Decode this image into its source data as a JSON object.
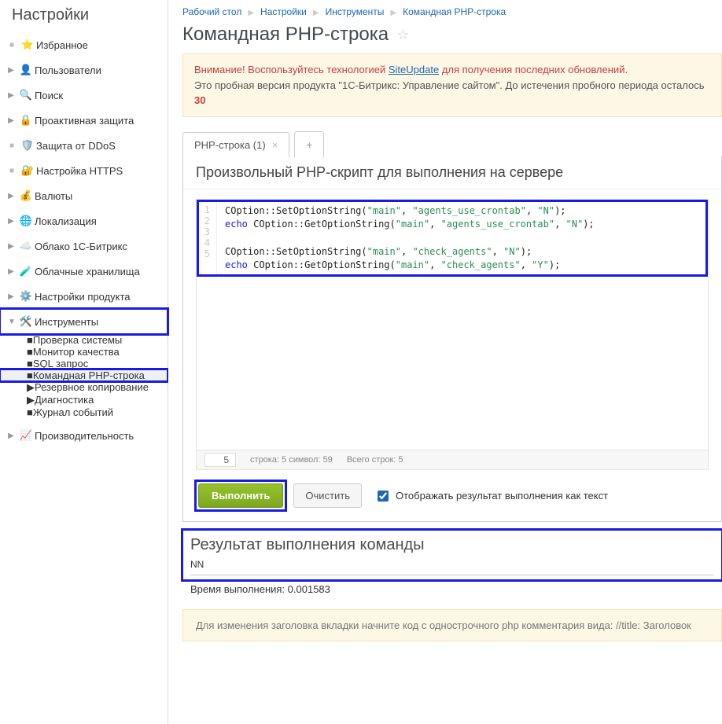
{
  "sidebar": {
    "title": "Настройки",
    "items": [
      {
        "label": "Избранное",
        "icon": "⭐",
        "arrow": "dot"
      },
      {
        "label": "Пользователи",
        "icon": "👤",
        "arrow": "tri"
      },
      {
        "label": "Поиск",
        "icon": "🔍",
        "arrow": "tri"
      },
      {
        "label": "Проактивная защита",
        "icon": "🔒",
        "arrow": "tri"
      },
      {
        "label": "Защита от DDoS",
        "icon": "🛡️",
        "arrow": "dot"
      },
      {
        "label": "Настройка HTTPS",
        "icon": "🔐",
        "arrow": "dot"
      },
      {
        "label": "Валюты",
        "icon": "💰",
        "arrow": "tri"
      },
      {
        "label": "Локализация",
        "icon": "🌐",
        "arrow": "tri"
      },
      {
        "label": "Облако 1С-Битрикс",
        "icon": "☁️",
        "arrow": "tri"
      },
      {
        "label": "Облачные хранилища",
        "icon": "🧪",
        "arrow": "tri"
      },
      {
        "label": "Настройки продукта",
        "icon": "⚙️",
        "arrow": "tri"
      },
      {
        "label": "Инструменты",
        "icon": "🛠️",
        "arrow": "down",
        "hl": true
      }
    ],
    "subitems": [
      {
        "label": "Проверка системы"
      },
      {
        "label": "Монитор качества"
      },
      {
        "label": "SQL запрос"
      },
      {
        "label": "Командная PHP-строка",
        "active": true,
        "hl": true
      },
      {
        "label": "Резервное копирование",
        "arrow": "tri"
      },
      {
        "label": "Диагностика",
        "arrow": "tri"
      },
      {
        "label": "Журнал событий"
      }
    ],
    "after": [
      {
        "label": "Производительность",
        "icon": "📈",
        "arrow": "tri"
      }
    ]
  },
  "breadcrumbs": [
    "Рабочий стол",
    "Настройки",
    "Инструменты",
    "Командная PHP-строка"
  ],
  "page_title": "Командная PHP-строка",
  "alert": {
    "warn_prefix": "Внимание! Воспользуйтесь технологией ",
    "link": "SiteUpdate",
    "warn_suffix": " для получения последних обновлений.",
    "line2_a": "Это пробная версия продукта \"1С-Битрикс: Управление сайтом\". До истечения пробного периода осталось ",
    "line2_b": "30"
  },
  "tab_label": "PHP-строка (1)",
  "tab_add": "+",
  "panel_title": "Произвольный PHP-скрипт для выполнения на сервере",
  "code_lines": [
    "1",
    "2",
    "3",
    "4",
    "5"
  ],
  "code_html": "COption::SetOptionString(<span class='str'>\"main\"</span>, <span class='str'>\"agents_use_crontab\"</span>, <span class='str'>\"N\"</span>);\n<span class='kw'>echo</span> COption::GetOptionString(<span class='str'>\"main\"</span>, <span class='str'>\"agents_use_crontab\"</span>, <span class='str'>\"N\"</span>);\n\nCOption::SetOptionString(<span class='str'>\"main\"</span>, <span class='str'>\"check_agents\"</span>, <span class='str'>\"N\"</span>);\n<span class='kw'>echo</span> COption::GetOptionString(<span class='str'>\"main\"</span>, <span class='str'>\"check_agents\"</span>, <span class='str'>\"Y\"</span>);",
  "status": {
    "current_line": "5",
    "pos": "строка: 5    символ: 59",
    "total": "Всего строк: 5"
  },
  "buttons": {
    "run": "Выполнить",
    "clear": "Очистить",
    "as_text": "Отображать результат выполнения как текст"
  },
  "result": {
    "title": "Результат выполнения команды",
    "output": "NN"
  },
  "timing_label": "Время выполнения: ",
  "timing_value": "0.001583",
  "hint": "Для изменения заголовка вкладки начните код с однострочного php комментария вида: //title: Заголовок"
}
